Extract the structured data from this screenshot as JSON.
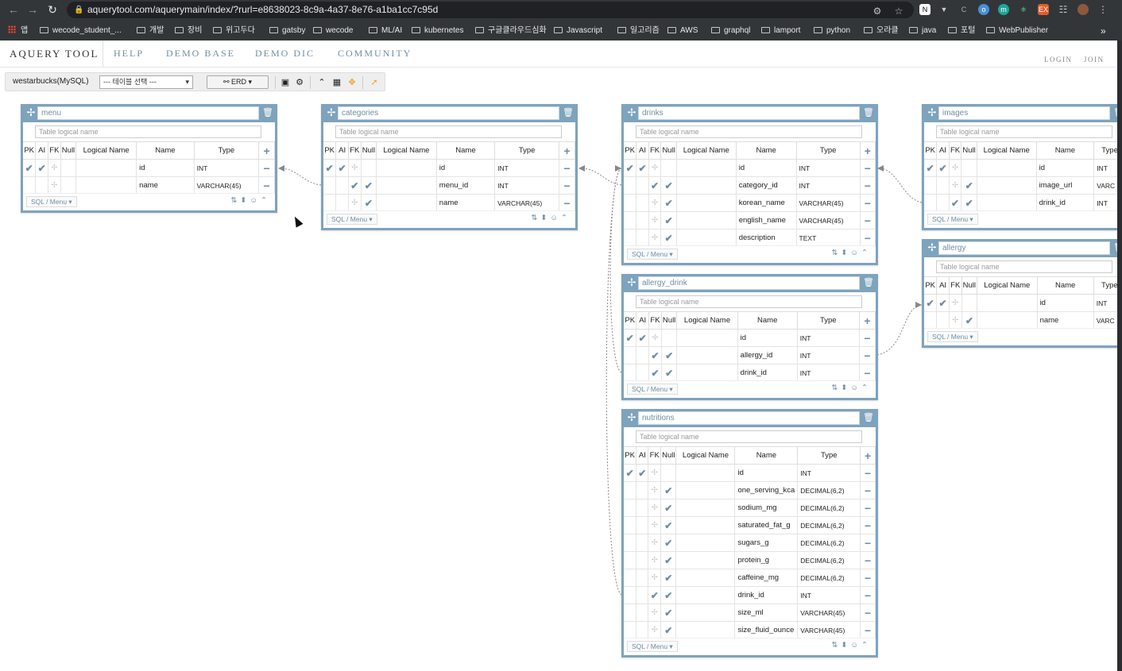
{
  "browser": {
    "url": "aquerytool.com/aquerymain/index/?rurl=e8638023-8c9a-4a37-8e76-a1ba1cc7c95d",
    "bookmarks": [
      {
        "label": "앱",
        "kind": "apps"
      },
      {
        "label": "wecode_student_...",
        "kind": "folder"
      },
      {
        "label": "개발",
        "kind": "folder"
      },
      {
        "label": "장비",
        "kind": "folder"
      },
      {
        "label": "위고두다",
        "kind": "folder"
      },
      {
        "label": "gatsby",
        "kind": "folder"
      },
      {
        "label": "wecode",
        "kind": "folder"
      },
      {
        "label": "ML/AI",
        "kind": "folder"
      },
      {
        "label": "kubernetes",
        "kind": "folder"
      },
      {
        "label": "구글클라우드심화",
        "kind": "folder"
      },
      {
        "label": "Javascript",
        "kind": "folder"
      },
      {
        "label": "일고리즘",
        "kind": "folder"
      },
      {
        "label": "AWS",
        "kind": "folder"
      },
      {
        "label": "graphql",
        "kind": "folder"
      },
      {
        "label": "lamport",
        "kind": "folder"
      },
      {
        "label": "python",
        "kind": "folder"
      },
      {
        "label": "오라클",
        "kind": "folder"
      },
      {
        "label": "java",
        "kind": "folder"
      },
      {
        "label": "포털",
        "kind": "folder"
      },
      {
        "label": "WebPublisher",
        "kind": "folder"
      }
    ],
    "more": "»"
  },
  "nav": {
    "brand": "AQUERY TOOL",
    "items": [
      "HELP",
      "DEMO BASE",
      "DEMO DIC",
      "COMMUNITY"
    ],
    "login": "LOGIN",
    "join": "JOIN"
  },
  "toolbar": {
    "db_name": "westarbucks(MySQL)",
    "table_select": "--- 테이블 선택 ---",
    "erd_button": "ERD"
  },
  "common": {
    "logical_placeholder": "Table logical name",
    "headers": [
      "PK",
      "AI",
      "FK",
      "Null",
      "Logical Name",
      "Name",
      "Type"
    ],
    "sql_menu": "SQL / Menu"
  },
  "tables": [
    {
      "name": "menu",
      "cols": [
        {
          "pk": true,
          "ai": true,
          "fk": false,
          "null": false,
          "name": "id",
          "type": "INT"
        },
        {
          "pk": false,
          "ai": false,
          "fk": false,
          "null": false,
          "name": "name",
          "type": "VARCHAR(45)"
        }
      ]
    },
    {
      "name": "categories",
      "cols": [
        {
          "pk": true,
          "ai": true,
          "fk": false,
          "null": false,
          "name": "id",
          "type": "INT"
        },
        {
          "pk": false,
          "ai": false,
          "fk": true,
          "null": true,
          "name": "menu_id",
          "type": "INT"
        },
        {
          "pk": false,
          "ai": false,
          "fk": false,
          "null": true,
          "name": "name",
          "type": "VARCHAR(45)"
        }
      ]
    },
    {
      "name": "drinks",
      "cols": [
        {
          "pk": true,
          "ai": true,
          "fk": false,
          "null": false,
          "name": "id",
          "type": "INT"
        },
        {
          "pk": false,
          "ai": false,
          "fk": true,
          "null": true,
          "name": "category_id",
          "type": "INT"
        },
        {
          "pk": false,
          "ai": false,
          "fk": false,
          "null": true,
          "name": "korean_name",
          "type": "VARCHAR(45)"
        },
        {
          "pk": false,
          "ai": false,
          "fk": false,
          "null": true,
          "name": "english_name",
          "type": "VARCHAR(45)"
        },
        {
          "pk": false,
          "ai": false,
          "fk": false,
          "null": true,
          "name": "description",
          "type": "TEXT"
        }
      ]
    },
    {
      "name": "images",
      "cols": [
        {
          "pk": true,
          "ai": true,
          "fk": false,
          "null": false,
          "name": "id",
          "type": "INT"
        },
        {
          "pk": false,
          "ai": false,
          "fk": false,
          "null": true,
          "name": "image_url",
          "type": "VARC"
        },
        {
          "pk": false,
          "ai": false,
          "fk": true,
          "null": true,
          "name": "drink_id",
          "type": "INT"
        }
      ]
    },
    {
      "name": "allergy",
      "cols": [
        {
          "pk": true,
          "ai": true,
          "fk": false,
          "null": false,
          "name": "id",
          "type": "INT"
        },
        {
          "pk": false,
          "ai": false,
          "fk": false,
          "null": true,
          "name": "name",
          "type": "VARC"
        }
      ]
    },
    {
      "name": "allergy_drink",
      "cols": [
        {
          "pk": true,
          "ai": true,
          "fk": false,
          "null": false,
          "name": "id",
          "type": "INT"
        },
        {
          "pk": false,
          "ai": false,
          "fk": true,
          "null": true,
          "name": "allergy_id",
          "type": "INT"
        },
        {
          "pk": false,
          "ai": false,
          "fk": true,
          "null": true,
          "name": "drink_id",
          "type": "INT"
        }
      ]
    },
    {
      "name": "nutritions",
      "cols": [
        {
          "pk": true,
          "ai": true,
          "fk": false,
          "null": false,
          "name": "id",
          "type": "INT"
        },
        {
          "pk": false,
          "ai": false,
          "fk": false,
          "null": true,
          "name": "one_serving_kca",
          "type": "DECIMAL(6,2)"
        },
        {
          "pk": false,
          "ai": false,
          "fk": false,
          "null": true,
          "name": "sodium_mg",
          "type": "DECIMAL(6,2)"
        },
        {
          "pk": false,
          "ai": false,
          "fk": false,
          "null": true,
          "name": "saturated_fat_g",
          "type": "DECIMAL(6,2)"
        },
        {
          "pk": false,
          "ai": false,
          "fk": false,
          "null": true,
          "name": "sugars_g",
          "type": "DECIMAL(6,2)"
        },
        {
          "pk": false,
          "ai": false,
          "fk": false,
          "null": true,
          "name": "protein_g",
          "type": "DECIMAL(6,2)"
        },
        {
          "pk": false,
          "ai": false,
          "fk": false,
          "null": true,
          "name": "caffeine_mg",
          "type": "DECIMAL(6,2)"
        },
        {
          "pk": false,
          "ai": false,
          "fk": true,
          "null": true,
          "name": "drink_id",
          "type": "INT"
        },
        {
          "pk": false,
          "ai": false,
          "fk": false,
          "null": true,
          "name": "size_ml",
          "type": "VARCHAR(45)"
        },
        {
          "pk": false,
          "ai": false,
          "fk": false,
          "null": true,
          "name": "size_fluid_ounce",
          "type": "VARCHAR(45)"
        }
      ]
    }
  ]
}
